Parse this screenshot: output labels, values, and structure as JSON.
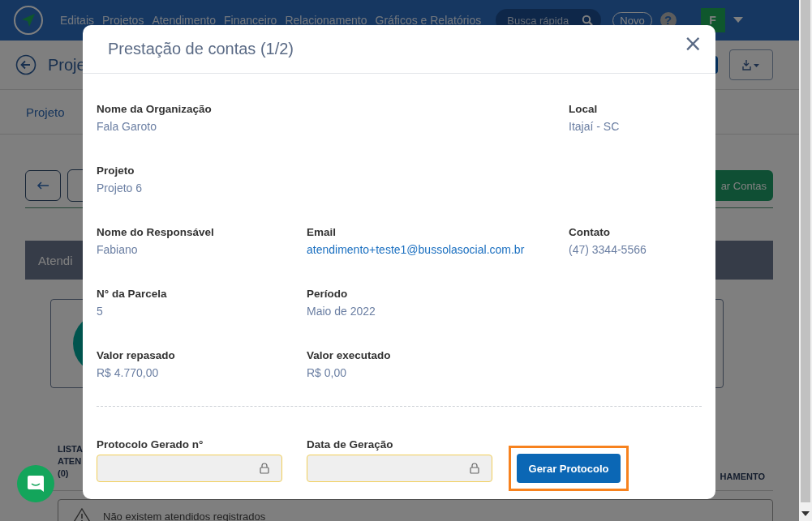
{
  "nav": {
    "items": [
      "Editais",
      "Projetos",
      "Atendimento",
      "Financeiro",
      "Relacionamento",
      "Gráficos e Relatórios"
    ],
    "search": {
      "placeholder": "Busca rápida"
    },
    "new_button": "Novo",
    "help": "?",
    "avatar": "F"
  },
  "page": {
    "title": "Proje",
    "tab": "Projeto",
    "action_button": "ar Contas",
    "panel_tab": "Atendi",
    "list_title": "LISTA ATEN (0)",
    "column_header": "HAMENTO",
    "empty_message": "Não existem atendidos registrados"
  },
  "modal": {
    "title": "Prestação de contas (1/2)",
    "close": "×",
    "rows": [
      {
        "left": {
          "label": "Nome da Organização",
          "value": "Fala Garoto",
          "kind": "text"
        },
        "right": {
          "label": "Local",
          "value": "Itajaí - SC",
          "kind": "text"
        }
      },
      {
        "left": {
          "label": "Projeto",
          "value": "Projeto 6",
          "kind": "text"
        }
      },
      {
        "left": {
          "label": "Nome do Responsável",
          "value": "Fabiano",
          "kind": "text"
        },
        "middle": {
          "label": "Email",
          "value": "atendimento+teste1@bussolasocial.com.br",
          "kind": "link"
        },
        "right": {
          "label": "Contato",
          "value": "(47) 3344-5566",
          "kind": "text"
        }
      },
      {
        "left": {
          "label": "N° da Parcela",
          "value": "5",
          "kind": "text"
        },
        "middle": {
          "label": "Período",
          "value": "Maio de 2022",
          "kind": "text"
        }
      },
      {
        "left": {
          "label": "Valor repasado",
          "value": "R$ 4.770,00",
          "kind": "text"
        },
        "middle": {
          "label": "Valor executado",
          "value": "R$ 0,00",
          "kind": "text"
        }
      }
    ],
    "protocol_fields": [
      {
        "label": "Protocolo Gerado n°",
        "locked": true
      },
      {
        "label": "Data de Geração",
        "locked": true
      }
    ],
    "button": {
      "label": "Gerar Protocolo",
      "highlighted": true
    }
  }
}
